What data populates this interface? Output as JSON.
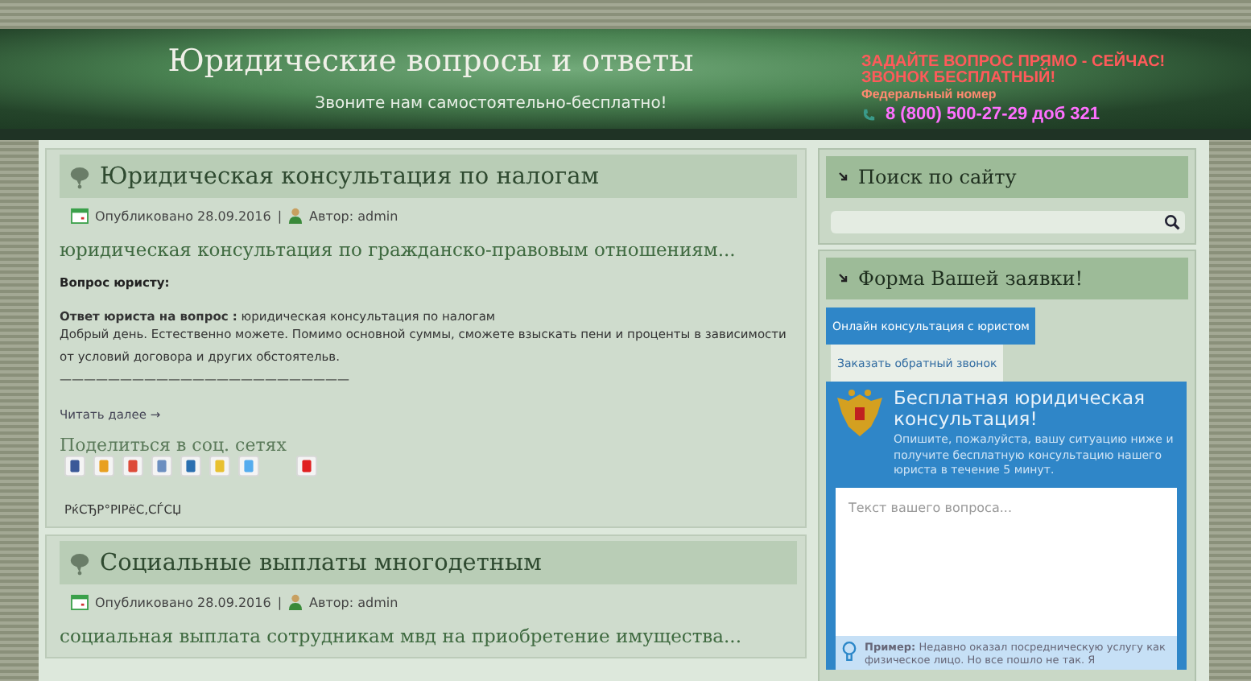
{
  "header": {
    "title": "Юридические вопросы и ответы",
    "tagline": "Звоните нам самостоятельно-бесплатно!",
    "cta_line1": "ЗАДАЙТЕ ВОПРОС ПРЯМО - СЕЙЧАС!",
    "cta_line2": "ЗВОНОК БЕСПЛАТНЫЙ!",
    "cta_label": "Федеральный номер",
    "phone": "8 (800) 500-27-29 доб 321"
  },
  "posts": [
    {
      "title": "Юридическая консультация по налогам",
      "published": "Опубликовано 28.09.2016",
      "separator": "|",
      "author": "Автор: admin",
      "subtitle": "юридическая консультация по гражданско-правовым отношениям...",
      "question": "Вопрос юристу:",
      "answer": "**Ответ юриста на вопрос :** юридическая консультация по налогам",
      "body": "Добрый день. Естественно можете. Помимо основной суммы, сможете взыскать пени и проценты в зависимости от условий договора и других обстоятельв.",
      "rule": "————————————————————————",
      "read_more": "Читать далее →",
      "share_title": "Поделиться в соц. сетях",
      "like": "РќСЂР°РІРёС‚СЃСЏ"
    },
    {
      "title": "Социальные выплаты многодетным",
      "published": "Опубликовано 28.09.2016",
      "separator": "|",
      "author": "Автор: admin",
      "subtitle": "социальная выплата сотрудникам мвд на приобретение имущества..."
    }
  ],
  "sidebar": {
    "search": {
      "title": "Поиск по сайту"
    },
    "form": {
      "title": "Форма Вашей заявки!",
      "tabs": [
        {
          "label": "Онлайн консультация с юристом",
          "selected": true
        },
        {
          "label": "Заказать обратный звонок",
          "selected": false
        }
      ],
      "heading": "Бесплатная юридическая консультация!",
      "description": "Опишите, пожалуйста, вашу ситуацию ниже и получите бесплатную консультацию нашего юриста в течение 5 минут.",
      "placeholder": "Текст вашего вопроса...",
      "example": "**Пример:** Недавно оказал посредническую услугу как физическое лицо. Но все пошло не так. Я"
    }
  }
}
